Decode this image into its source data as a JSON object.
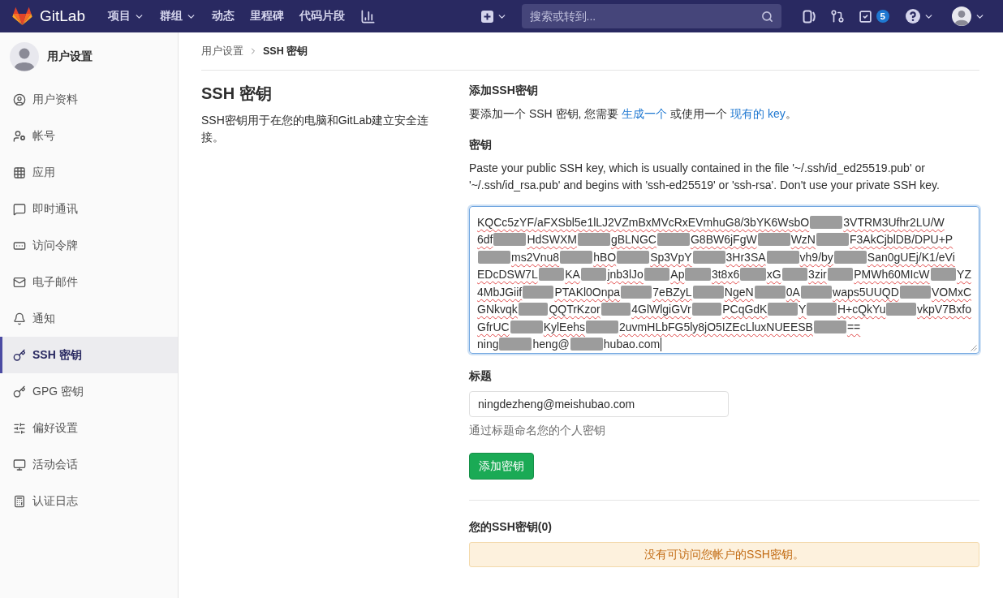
{
  "top_bar": {
    "brand": "GitLab",
    "nav": [
      {
        "label": "项目",
        "dropdown": true
      },
      {
        "label": "群组",
        "dropdown": true
      },
      {
        "label": "动态",
        "dropdown": false
      },
      {
        "label": "里程碑",
        "dropdown": false
      },
      {
        "label": "代码片段",
        "dropdown": false
      }
    ],
    "search": {
      "placeholder": "搜索或转到..."
    },
    "todo_badge": "5"
  },
  "sidebar": {
    "title": "用户设置",
    "items": [
      {
        "label": "用户资料",
        "selected": false
      },
      {
        "label": "帐号",
        "selected": false
      },
      {
        "label": "应用",
        "selected": false
      },
      {
        "label": "即时通讯",
        "selected": false
      },
      {
        "label": "访问令牌",
        "selected": false
      },
      {
        "label": "电子邮件",
        "selected": false
      },
      {
        "label": "通知",
        "selected": false
      },
      {
        "label": "SSH 密钥",
        "selected": true
      },
      {
        "label": "GPG 密钥",
        "selected": false
      },
      {
        "label": "偏好设置",
        "selected": false
      },
      {
        "label": "活动会话",
        "selected": false
      },
      {
        "label": "认证日志",
        "selected": false
      }
    ]
  },
  "breadcrumb": [
    {
      "label": "用户设置",
      "current": false
    },
    {
      "label": "SSH 密钥",
      "current": true
    }
  ],
  "intro": {
    "title": "SSH 密钥",
    "description": "SSH密钥用于在您的电脑和GitLab建立安全连接。"
  },
  "add_key": {
    "heading": "添加SSH密钥",
    "instruction": [
      {
        "kind": "text",
        "text": "要添加一个 SSH 密钥, 您需要 "
      },
      {
        "kind": "link",
        "text": "生成一个"
      },
      {
        "kind": "text",
        "text": " 或使用一个 "
      },
      {
        "kind": "link",
        "text": "现有的 key"
      },
      {
        "kind": "text",
        "text": "。"
      }
    ],
    "key_label": "密钥",
    "key_help": "Paste your public SSH key, which is usually contained in the file '~/.ssh/id_ed25519.pub' or '~/.ssh/id_rsa.pub' and begins with 'ssh-ed25519' or 'ssh-rsa'. Don't use your private SSH key.",
    "key_field": {
      "focused": true,
      "lines": [
        {
          "misspelled": true,
          "segments": [
            {
              "kind": "text",
              "text": "KQCc5zYF/aFXSbl5e1lLJ2VZmBxMVcRxEVmhuG8/3bYK6WsbO"
            },
            {
              "kind": "redaction"
            },
            {
              "kind": "text",
              "text": "3VTRM3Ufhr2LU/W"
            }
          ]
        },
        {
          "misspelled": true,
          "segments": [
            {
              "kind": "text",
              "text": "6df"
            },
            {
              "kind": "redaction"
            },
            {
              "kind": "text",
              "text": "HdSWXM"
            },
            {
              "kind": "redaction"
            },
            {
              "kind": "text",
              "text": "gBLNGC"
            },
            {
              "kind": "redaction"
            },
            {
              "kind": "text",
              "text": "G8BW6jFgW"
            },
            {
              "kind": "redaction"
            },
            {
              "kind": "text",
              "text": "WzN"
            },
            {
              "kind": "redaction"
            },
            {
              "kind": "text",
              "text": "F3AkCjblDB/DPU+P"
            }
          ]
        },
        {
          "misspelled": true,
          "segments": [
            {
              "kind": "redaction"
            },
            {
              "kind": "text",
              "text": "ms2Vnu8"
            },
            {
              "kind": "redaction"
            },
            {
              "kind": "text",
              "text": "hBO"
            },
            {
              "kind": "redaction"
            },
            {
              "kind": "text",
              "text": "Sp3VpY"
            },
            {
              "kind": "redaction"
            },
            {
              "kind": "text",
              "text": "3Hr3SA"
            },
            {
              "kind": "redaction"
            },
            {
              "kind": "text",
              "text": "vh9/by"
            },
            {
              "kind": "redaction"
            },
            {
              "kind": "text",
              "text": "San0gUEj/K1/eVi"
            }
          ]
        },
        {
          "misspelled": true,
          "segments": [
            {
              "kind": "text",
              "text": "EDcDSW7L"
            },
            {
              "kind": "redaction"
            },
            {
              "kind": "text",
              "text": "KA"
            },
            {
              "kind": "redaction"
            },
            {
              "kind": "text",
              "text": "jnb3lJo"
            },
            {
              "kind": "redaction"
            },
            {
              "kind": "text",
              "text": "Ap"
            },
            {
              "kind": "redaction"
            },
            {
              "kind": "text",
              "text": "3t8x6"
            },
            {
              "kind": "redaction"
            },
            {
              "kind": "text",
              "text": "xG"
            },
            {
              "kind": "redaction"
            },
            {
              "kind": "text",
              "text": "3zir"
            },
            {
              "kind": "redaction"
            },
            {
              "kind": "text",
              "text": "PMWh60MIcW"
            },
            {
              "kind": "redaction"
            },
            {
              "kind": "text",
              "text": "YZ"
            }
          ]
        },
        {
          "misspelled": true,
          "segments": [
            {
              "kind": "text",
              "text": "4MbJGiif"
            },
            {
              "kind": "redaction"
            },
            {
              "kind": "text",
              "text": "PTAKl0Onpa"
            },
            {
              "kind": "redaction"
            },
            {
              "kind": "text",
              "text": "7eBZyL"
            },
            {
              "kind": "redaction"
            },
            {
              "kind": "text",
              "text": "NgeN"
            },
            {
              "kind": "redaction"
            },
            {
              "kind": "text",
              "text": "0A"
            },
            {
              "kind": "redaction"
            },
            {
              "kind": "text",
              "text": "waps5UUQD"
            },
            {
              "kind": "redaction"
            },
            {
              "kind": "text",
              "text": "VOMxC"
            }
          ]
        },
        {
          "misspelled": true,
          "segments": [
            {
              "kind": "text",
              "text": "GNkvqk"
            },
            {
              "kind": "redaction"
            },
            {
              "kind": "text",
              "text": "QQTrKzor"
            },
            {
              "kind": "redaction"
            },
            {
              "kind": "text",
              "text": "4GlWlgiGVr"
            },
            {
              "kind": "redaction"
            },
            {
              "kind": "text",
              "text": "PCqGdK"
            },
            {
              "kind": "redaction"
            },
            {
              "kind": "text",
              "text": "Y"
            },
            {
              "kind": "redaction"
            },
            {
              "kind": "text",
              "text": "H+cQkYu"
            },
            {
              "kind": "redaction"
            },
            {
              "kind": "text",
              "text": "vkpV7Bxfo"
            }
          ]
        },
        {
          "misspelled": true,
          "segments": [
            {
              "kind": "text",
              "text": "GfrUC"
            },
            {
              "kind": "redaction"
            },
            {
              "kind": "text",
              "text": "KylEehs"
            },
            {
              "kind": "redaction"
            },
            {
              "kind": "text",
              "text": "2uvmHLbFG5ly8jO5IZEcLluxNUEESB"
            },
            {
              "kind": "redaction"
            },
            {
              "kind": "text",
              "text": "=="
            }
          ]
        },
        {
          "misspelled": false,
          "segments": [
            {
              "kind": "text",
              "text": "ning"
            },
            {
              "kind": "redaction"
            },
            {
              "kind": "text",
              "text": "heng@"
            },
            {
              "kind": "redaction"
            },
            {
              "kind": "text",
              "text": "hubao.com"
            }
          ]
        }
      ]
    },
    "title_label": "标题",
    "title_field": {
      "value": "ningdezheng@meishubao.com"
    },
    "title_hint": "通过标题命名您的个人密钥",
    "submit": "添加密钥"
  },
  "your_keys": {
    "heading": "您的SSH密钥(0)",
    "empty_message": "没有可访问您帐户的SSH密钥。"
  }
}
